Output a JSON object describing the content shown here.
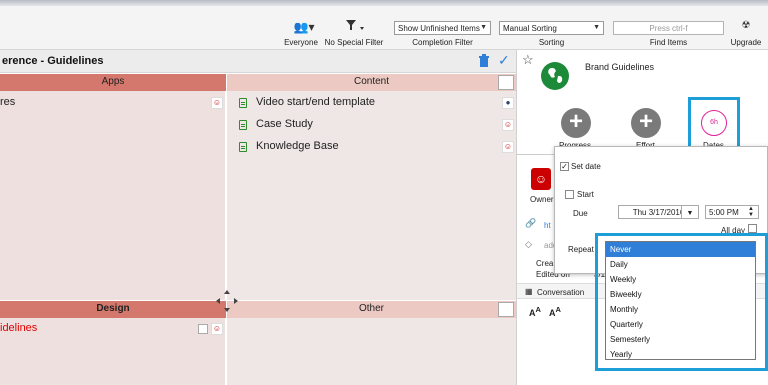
{
  "toolbar": {
    "everyone": "Everyone",
    "no_special_filter": "No Special Filter",
    "completion_filter_value": "Show Unfinished Items",
    "completion_filter_label": "Completion Filter",
    "sorting_value": "Manual Sorting",
    "sorting_label": "Sorting",
    "search_placeholder": "Press ctrl-f",
    "find_items_label": "Find Items",
    "upgrade_label": "Upgrade"
  },
  "matrix": {
    "title": "erence - Guidelines",
    "quadrants": {
      "apps": "Apps",
      "content": "Content",
      "design": "Design",
      "other": "Other"
    },
    "apps_items": [
      "res"
    ],
    "content_items": [
      "Video start/end template",
      "Case Study",
      "Knowledge Base"
    ],
    "design_items": [
      "idelines"
    ]
  },
  "panel": {
    "item_title": "Brand Guidelines",
    "progress_label": "Progress",
    "effort_label": "Effort",
    "dates_label": "Dates",
    "dates_value": "6h",
    "owner_label": "Owner",
    "link_text": "ht",
    "add_text": "ado",
    "created_label": "Crea",
    "edited_label": "Edited on",
    "edited_value": "3/1",
    "conversation_label": "Conversation"
  },
  "date_popup": {
    "set_date_label": "Set date",
    "start_label": "Start",
    "due_label": "Due",
    "due_date": "Thu 3/17/2016",
    "due_time": "5:00 PM",
    "all_day_label": "All day",
    "repeat_label": "Repeat"
  },
  "repeat_options": [
    "Never",
    "Daily",
    "Weekly",
    "Biweekly",
    "Monthly",
    "Quarterly",
    "Semesterly",
    "Yearly"
  ],
  "colors": {
    "apps_header": "#d4776c",
    "content_header": "#ecc9c3",
    "design_header": "#d4776c",
    "other_header": "#ecc9c3",
    "highlight": "#1e9ed8",
    "selected": "#2f7fd8",
    "red_text": "#e00000"
  }
}
